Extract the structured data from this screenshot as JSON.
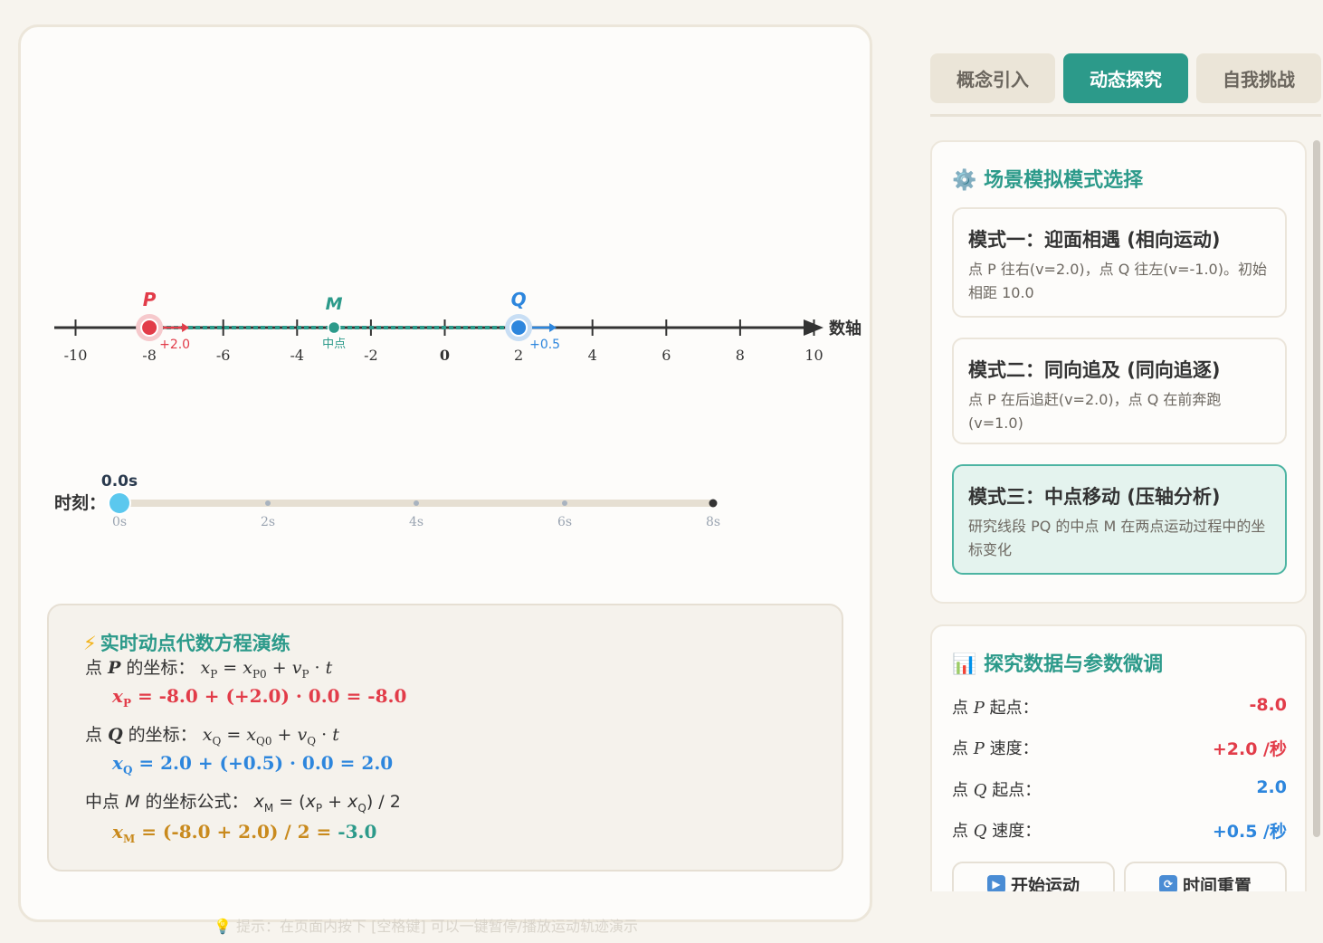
{
  "tabs": [
    {
      "label": "概念引入",
      "active": false
    },
    {
      "label": "动态探究",
      "active": true
    },
    {
      "label": "自我挑战",
      "active": false
    }
  ],
  "numberline": {
    "axis_label": "数轴",
    "ticks": [
      -10,
      -8,
      -6,
      -4,
      -2,
      0,
      2,
      4,
      6,
      8,
      10
    ],
    "tick_labels": [
      "-10",
      "-8",
      "-6",
      "-4",
      "-2",
      "0",
      "2",
      "4",
      "6",
      "8",
      "10"
    ],
    "point_p": {
      "label": "P",
      "position": -8.0,
      "velocity_label": "+2.0",
      "color": "#e23c49"
    },
    "point_q": {
      "label": "Q",
      "position": 2.0,
      "velocity_label": "+0.5",
      "color": "#2d86dd"
    },
    "point_m": {
      "label": "M",
      "position": -3.0,
      "sub_label": "中点",
      "color": "#2c9a8a"
    }
  },
  "timeline": {
    "label": "时刻：",
    "current": "0.0s",
    "current_value": 0.0,
    "max_value": 8,
    "ticks": [
      "0s",
      "2s",
      "4s",
      "6s",
      "8s"
    ]
  },
  "equations": {
    "title": "实时动点代数方程演练",
    "p_prefix": "点",
    "p_name": "P",
    "p_suffix": "的坐标：",
    "p_result": "= -8.0 + (+2.0) · 0.0 = -8.0",
    "q_prefix": "点",
    "q_name": "Q",
    "q_suffix": "的坐标：",
    "q_result": "= 2.0 + (+0.5) · 0.0 = 2.0",
    "m_prefix": "中点",
    "m_name": "M",
    "m_suffix": "的坐标公式：",
    "m_formula_tail": ") / 2",
    "m_result_expr": "= (-8.0 + 2.0) / 2 = ",
    "m_result_value": "-3.0"
  },
  "hint": "💡 提示：在页面内按下 [空格键] 可以一键暂停/播放运动轨迹演示",
  "modes_panel": {
    "title": "场景模拟模式选择",
    "modes": [
      {
        "title": "模式一：迎面相遇 (相向运动)",
        "desc": "点 P 往右(v=2.0)，点 Q 往左(v=-1.0)。初始相距 10.0",
        "active": false
      },
      {
        "title": "模式二：同向追及 (同向追逐)",
        "desc": "点 P 在后追赶(v=2.0)，点 Q 在前奔跑(v=1.0)",
        "active": false
      },
      {
        "title": "模式三：中点移动 (压轴分析)",
        "desc": "研究线段 PQ 的中点 M 在两点运动过程中的坐标变化",
        "active": true
      }
    ]
  },
  "data_panel": {
    "title": "探究数据与参数微调",
    "rows": [
      {
        "label_pre": "点",
        "label_var": "P",
        "label_post": "起点：",
        "value": "-8.0",
        "color": "red"
      },
      {
        "label_pre": "点",
        "label_var": "P",
        "label_post": "速度：",
        "value": "+2.0 /秒",
        "color": "red"
      },
      {
        "label_pre": "点",
        "label_var": "Q",
        "label_post": "起点：",
        "value": "2.0",
        "color": "blue"
      },
      {
        "label_pre": "点",
        "label_var": "Q",
        "label_post": "速度：",
        "value": "+0.5 /秒",
        "color": "blue"
      }
    ],
    "start_button": "开始运动",
    "reset_button": "时间重置"
  }
}
